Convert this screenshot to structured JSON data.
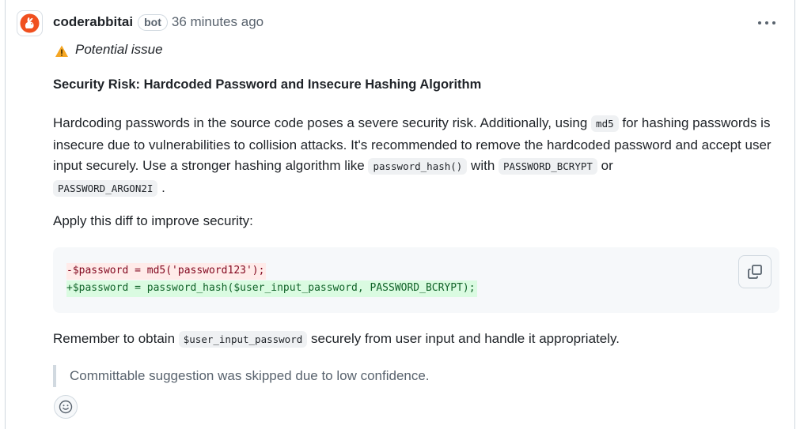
{
  "comment": {
    "author": "coderabbitai",
    "badge": "bot",
    "timestamp": "36 minutes ago",
    "more_actions_label": "More actions",
    "severity": {
      "icon": "warning-icon",
      "label": "Potential issue",
      "color": "#f5a623"
    },
    "title": "Security Risk: Hardcoded Password and Insecure Hashing Algorithm",
    "body": {
      "seg1": "Hardcoding passwords in the source code poses a severe security risk. Additionally, using ",
      "code1": "md5",
      "seg2": " for hashing passwords is insecure due to vulnerabilities to collision attacks. It's recommended to remove the hardcoded password and accept user input securely. Use a stronger hashing algorithm like ",
      "code2": "password_hash()",
      "seg3": " with ",
      "code3": "PASSWORD_BCRYPT",
      "seg4": " or ",
      "code4": "PASSWORD_ARGON2I",
      "seg5": " ."
    },
    "apply_text": "Apply this diff to improve security:",
    "diff": {
      "removed": "-$password = md5('password123');",
      "added": "+$password = password_hash($user_input_password, PASSWORD_BCRYPT);",
      "copy_icon": "copy-icon"
    },
    "remember": {
      "seg1": "Remember to obtain ",
      "code": "$user_input_password",
      "seg2": " securely from user input and handle it appropriately."
    },
    "quote": "Committable suggestion was skipped due to low confidence.",
    "reaction_icon": "smiley-icon"
  },
  "colors": {
    "brand_avatar": "#f24e1e",
    "removed_bg": "#ffebe9",
    "removed_fg": "#82071e",
    "added_bg": "#dafbe1",
    "added_fg": "#116329"
  }
}
